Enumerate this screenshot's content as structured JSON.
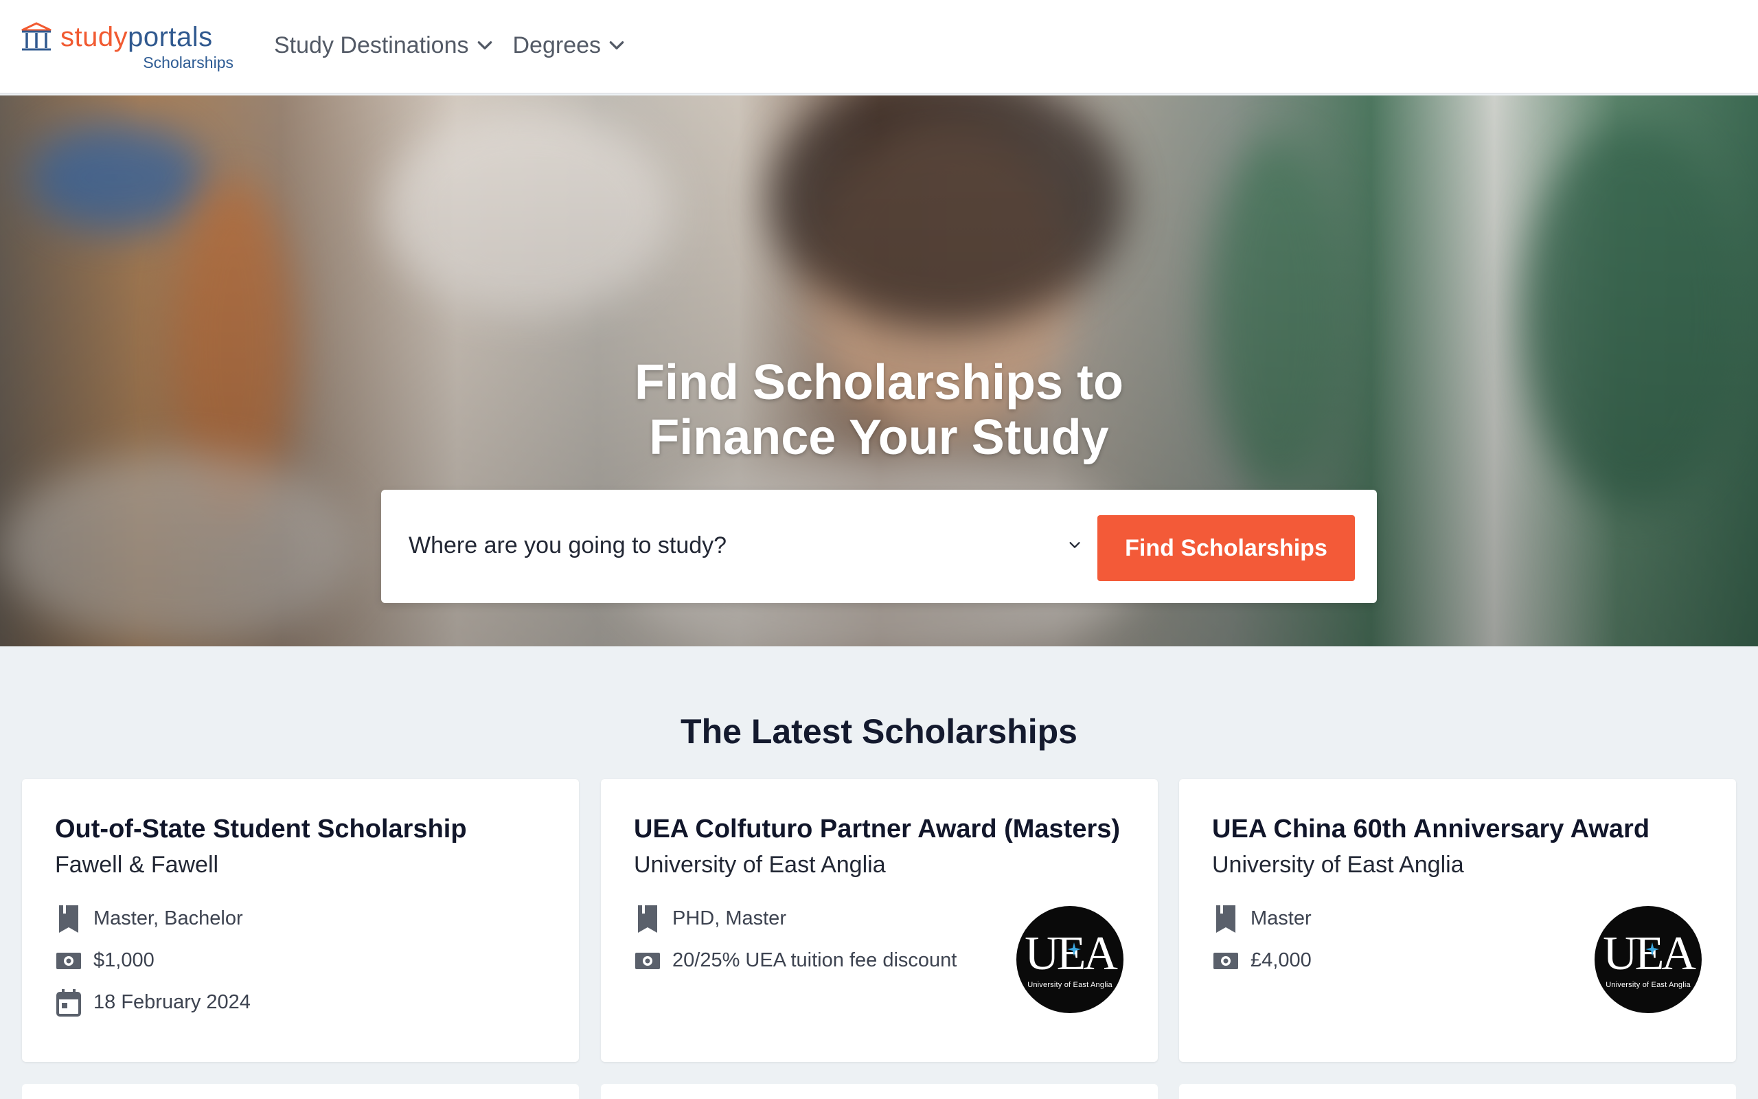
{
  "header": {
    "logo": {
      "word_part1": "study",
      "word_part2": "portals",
      "subtitle": "Scholarships"
    },
    "nav": [
      {
        "label": "Study Destinations",
        "icon": "chevron-down-icon"
      },
      {
        "label": "Degrees",
        "icon": "chevron-down-icon"
      }
    ]
  },
  "hero": {
    "title_line1": "Find Scholarships to",
    "title_line2": "Finance Your Study",
    "search": {
      "select_value": "Where are you going to study?",
      "button_label": "Find Scholarships"
    }
  },
  "latest": {
    "title": "The Latest Scholarships",
    "cards": [
      {
        "title": "Out-of-State Student Scholarship",
        "provider": "Fawell & Fawell",
        "degrees": "Master, Bachelor",
        "amount": "$1,000",
        "deadline": "18 February 2024"
      },
      {
        "title": "UEA Colfuturo Partner Award (Masters)",
        "provider": "University of East Anglia",
        "degrees": "PHD, Master",
        "amount": "20/25% UEA tuition fee discount",
        "logo_text": "UEA",
        "logo_caption": "University of East Anglia"
      },
      {
        "title": "UEA China 60th Anniversary Award",
        "provider": "University of East Anglia",
        "degrees": "Master",
        "amount": "£4,000",
        "logo_text": "UEA",
        "logo_caption": "University of East Anglia"
      }
    ]
  },
  "colors": {
    "accent": "#f35a38",
    "brand_orange": "#f15a31",
    "brand_blue": "#30598f",
    "background": "#edf1f4"
  }
}
